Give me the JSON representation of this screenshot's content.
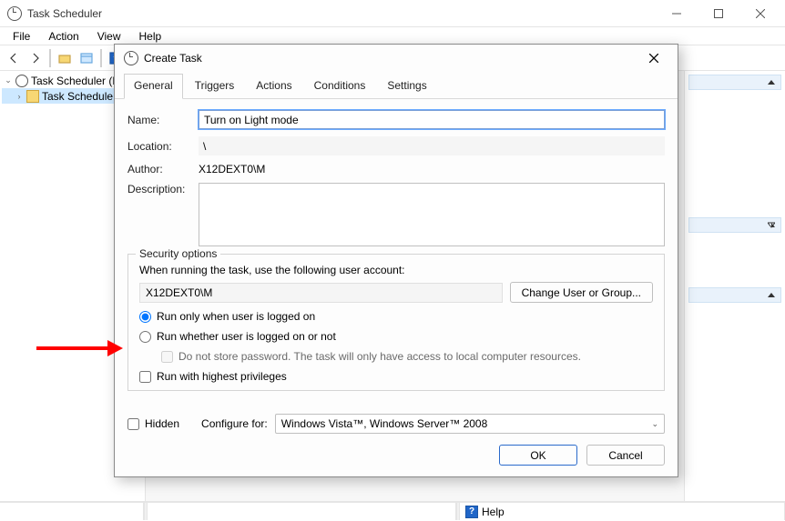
{
  "window": {
    "title": "Task Scheduler",
    "menu": {
      "file": "File",
      "action": "Action",
      "view": "View",
      "help": "Help"
    }
  },
  "tree": {
    "root": "Task Scheduler (L",
    "child": "Task Schedule"
  },
  "statusbar": {
    "help": "Help"
  },
  "dialog": {
    "title": "Create Task",
    "tabs": {
      "general": "General",
      "triggers": "Triggers",
      "actions": "Actions",
      "conditions": "Conditions",
      "settings": "Settings"
    },
    "general": {
      "name_label": "Name:",
      "name_value": "Turn on Light mode",
      "location_label": "Location:",
      "location_value": "\\",
      "author_label": "Author:",
      "author_value": "X12DEXT0\\M",
      "description_label": "Description:",
      "description_value": ""
    },
    "security": {
      "legend": "Security options",
      "prompt": "When running the task, use the following user account:",
      "account": "X12DEXT0\\M",
      "change_user": "Change User or Group...",
      "run_logged_on": "Run only when user is logged on",
      "run_whether": "Run whether user is logged on or not",
      "no_store_pw": "Do not store password.  The task will only have access to local computer resources.",
      "highest_priv": "Run with highest privileges"
    },
    "bottom": {
      "hidden": "Hidden",
      "configure_for_label": "Configure for:",
      "configure_for_value": "Windows Vista™, Windows Server™ 2008"
    },
    "buttons": {
      "ok": "OK",
      "cancel": "Cancel"
    }
  }
}
